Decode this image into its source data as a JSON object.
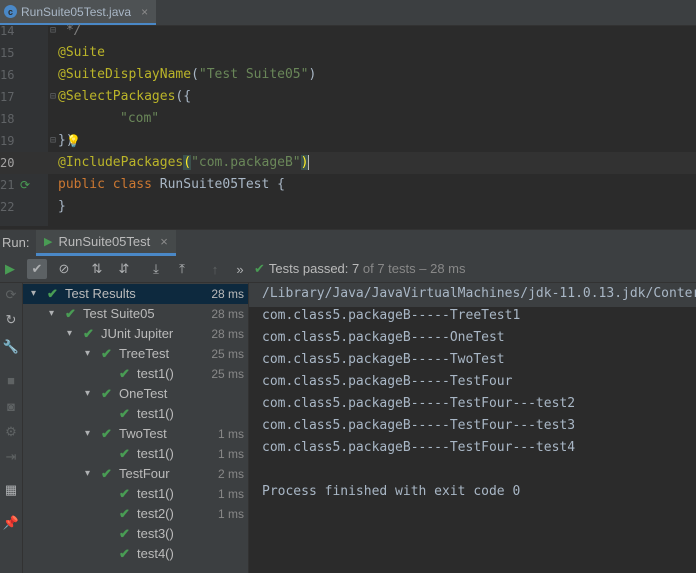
{
  "editor_tab": {
    "file_name": "RunSuite05Test.java",
    "close": "×"
  },
  "editor": {
    "line_numbers": [
      "14",
      "15",
      "16",
      "17",
      "18",
      "19",
      "20",
      "21",
      "22"
    ],
    "l14": "*/",
    "l15": "@Suite",
    "l16_ann": "@SuiteDisplayName",
    "l16_open": "(",
    "l16_str": "\"Test Suite05\"",
    "l16_close": ")",
    "l17_ann": "@SelectPackages",
    "l17_rest": "({",
    "l18_str": "\"com\"",
    "l19": "})",
    "l20_ann": "@IncludePackages",
    "l20_open": "(",
    "l20_str": "\"com.packageB\"",
    "l20_close": ")",
    "l21_kw1": "public",
    "l21_kw2": "class",
    "l21_name": "RunSuite05Test {",
    "l22": "}"
  },
  "run_panel": {
    "label": "Run:",
    "tab_title": "RunSuite05Test",
    "close": "×",
    "status": {
      "prefix": "Tests passed:",
      "count": "7",
      "rest": "of 7 tests – 28 ms"
    }
  },
  "tree": [
    {
      "name": "Test Results",
      "time": "28 ms",
      "level": 0,
      "expanded": true,
      "selected": true
    },
    {
      "name": "Test Suite05",
      "time": "28 ms",
      "level": 1,
      "expanded": true
    },
    {
      "name": "JUnit Jupiter",
      "time": "28 ms",
      "level": 2,
      "expanded": true
    },
    {
      "name": "TreeTest",
      "time": "25 ms",
      "level": 3,
      "expanded": true
    },
    {
      "name": "test1()",
      "time": "25 ms",
      "level": 4
    },
    {
      "name": "OneTest",
      "time": "",
      "level": 3,
      "expanded": true
    },
    {
      "name": "test1()",
      "time": "",
      "level": 4
    },
    {
      "name": "TwoTest",
      "time": "1 ms",
      "level": 3,
      "expanded": true
    },
    {
      "name": "test1()",
      "time": "1 ms",
      "level": 4
    },
    {
      "name": "TestFour",
      "time": "2 ms",
      "level": 3,
      "expanded": true
    },
    {
      "name": "test1()",
      "time": "1 ms",
      "level": 4
    },
    {
      "name": "test2()",
      "time": "1 ms",
      "level": 4
    },
    {
      "name": "test3()",
      "time": "",
      "level": 4
    },
    {
      "name": "test4()",
      "time": "",
      "level": 4
    }
  ],
  "console": {
    "path": "/Library/Java/JavaVirtualMachines/jdk-11.0.13.jdk/Conter",
    "lines": [
      "com.class5.packageB-----TreeTest1",
      "com.class5.packageB-----OneTest",
      "com.class5.packageB-----TwoTest",
      "com.class5.packageB-----TestFour",
      "com.class5.packageB-----TestFour---test2",
      "com.class5.packageB-----TestFour---test3",
      "com.class5.packageB-----TestFour---test4",
      "",
      "Process finished with exit code 0"
    ]
  },
  "colors": {
    "accent": "#4a88c7",
    "pass": "#499c54",
    "annotation": "#bbb529",
    "string": "#6a8759",
    "keyword": "#cc7832"
  },
  "icons": [
    "java-class-icon",
    "run-icon",
    "check-icon",
    "stop-icon",
    "sort-alpha-icon",
    "sort-duration-icon",
    "expand-all-icon",
    "collapse-all-icon",
    "up-arrow-icon",
    "more-icon",
    "rerun-icon",
    "settings-icon",
    "wrench-icon",
    "camera-icon",
    "gear-icon",
    "exit-icon",
    "layout-icon",
    "pin-icon",
    "bulb-icon"
  ]
}
